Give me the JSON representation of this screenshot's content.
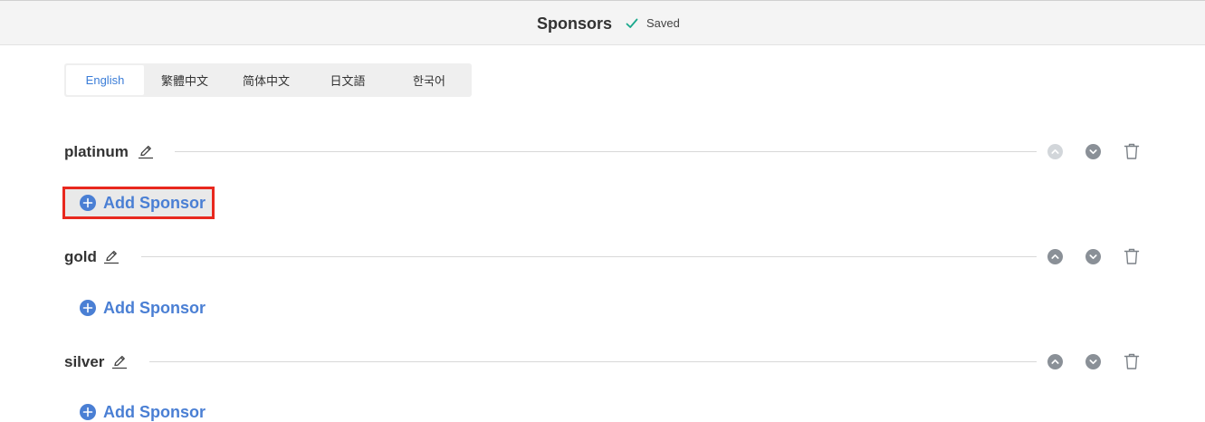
{
  "header": {
    "title": "Sponsors",
    "status": "Saved",
    "colors": {
      "background": "#f4f4f4",
      "check": "#1aa88c"
    }
  },
  "language_tabs": [
    {
      "label": "English",
      "active": true
    },
    {
      "label": "繁體中文",
      "active": false
    },
    {
      "label": "简体中文",
      "active": false
    },
    {
      "label": "日文語",
      "active": false
    },
    {
      "label": "한국어",
      "active": false
    }
  ],
  "sections": [
    {
      "name": "platinum",
      "add_label": "Add Sponsor",
      "move_up_enabled": false,
      "move_down_enabled": true
    },
    {
      "name": "gold",
      "add_label": "Add Sponsor",
      "move_up_enabled": true,
      "move_down_enabled": true
    },
    {
      "name": "silver",
      "add_label": "Add Sponsor",
      "move_up_enabled": true,
      "move_down_enabled": true
    }
  ],
  "icons": {
    "edit": "pencil-icon",
    "move_up": "chevron-up-circle-icon",
    "move_down": "chevron-down-circle-icon",
    "delete": "trash-icon",
    "add": "plus-circle-icon",
    "saved": "check-icon"
  },
  "colors": {
    "accent": "#4a7fd4",
    "highlight_border": "#e8281e",
    "control_gray": "#8a9097",
    "control_disabled": "#d2d6da"
  }
}
